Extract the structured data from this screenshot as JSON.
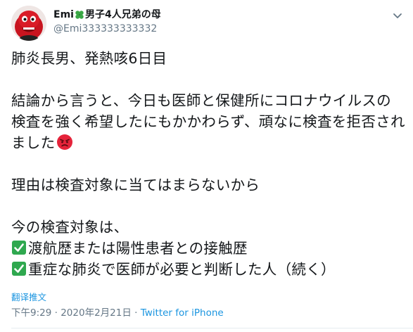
{
  "author": {
    "name_prefix": "Emi",
    "name_icon": "four-leaf-clover-icon",
    "name_suffix": "男子4人兄弟の母",
    "handle": "@Emi333333333332",
    "avatar_icon": "avatar-red-character"
  },
  "tweet": {
    "line1": "肺炎長男、発熱咳6日目",
    "para2": "結論から言うと、今日も医師と保健所にコロナウイルスの検査を強く希望したにもかかわらず、頑なに検査を拒否されました",
    "para2_emoji": "angry-face-icon",
    "para3": "理由は検査対象に当てはまらないから",
    "para4_intro": "今の検査対象は、",
    "criteria": [
      {
        "icon": "check-mark-icon",
        "text": "渡航歴または陽性患者との接触歴"
      },
      {
        "icon": "check-mark-icon",
        "text": "重症な肺炎で医師が必要と判断した人（続く）"
      }
    ]
  },
  "translate_label": "翻译推文",
  "meta": {
    "time": "下午9:29",
    "separator": "·",
    "date": "2020年2月21日",
    "source": "Twitter for iPhone"
  },
  "colors": {
    "text": "#14171a",
    "secondary": "#657786",
    "link": "#1b95e0",
    "check_bg": "#2fa84f",
    "angry": "#e5233a"
  }
}
